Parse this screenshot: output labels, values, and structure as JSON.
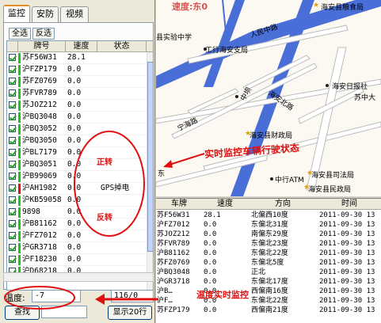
{
  "left": {
    "tabs": [
      "监控",
      "安防",
      "视频"
    ],
    "buttons": {
      "select_all": "全选",
      "invert": "反选"
    },
    "columns": [
      "牌号",
      "速度",
      "状态"
    ],
    "rows": [
      {
        "plate": "苏F56W31",
        "speed": "28.1",
        "status": "",
        "color": "#22c022"
      },
      {
        "plate": "沪FZP179",
        "speed": "0.0",
        "status": "",
        "color": "#22c022"
      },
      {
        "plate": "苏FZ0769",
        "speed": "0.0",
        "status": "",
        "color": "#22c022"
      },
      {
        "plate": "苏FVR789",
        "speed": "0.0",
        "status": "",
        "color": "#22c022"
      },
      {
        "plate": "苏JOZ212",
        "speed": "0.0",
        "status": "",
        "color": "#22c022"
      },
      {
        "plate": "沪BQ3048",
        "speed": "0.0",
        "status": "",
        "color": "#22c022"
      },
      {
        "plate": "沪BQ3052",
        "speed": "0.0",
        "status": "",
        "color": "#22c022"
      },
      {
        "plate": "沪BQ3050",
        "speed": "0.0",
        "status": "",
        "color": "#22c022"
      },
      {
        "plate": "沪BL7179",
        "speed": "0.0",
        "status": "",
        "color": "#22c022"
      },
      {
        "plate": "沪BQ3051",
        "speed": "0.0",
        "status": "",
        "color": "#22c022"
      },
      {
        "plate": "沪B99069",
        "speed": "0.0",
        "status": "",
        "color": "#22c022"
      },
      {
        "plate": "沪AH1982",
        "speed": "0.0",
        "status": "GPS掉电",
        "color": "#e01010"
      },
      {
        "plate": "沪KB59058",
        "speed": "0.0",
        "status": "",
        "color": "#22c022"
      },
      {
        "plate": "9898",
        "speed": "0.0",
        "status": "",
        "color": "#22c022"
      },
      {
        "plate": "沪B81162",
        "speed": "0.0",
        "status": "",
        "color": "#22c022"
      },
      {
        "plate": "沪FZ7012",
        "speed": "0.0",
        "status": "",
        "color": "#22c022"
      },
      {
        "plate": "沪GR3718",
        "speed": "0.0",
        "status": "",
        "color": "#22c022"
      },
      {
        "plate": "沪F18230",
        "speed": "0.0",
        "status": "",
        "color": "#22c022"
      },
      {
        "plate": "沪D68218",
        "speed": "0.0",
        "status": "",
        "color": "#22c022"
      }
    ],
    "temp_label": "温度:",
    "temp_value": "-7",
    "other_value": "116/0",
    "find_button": "查找",
    "show_button": "显示20行"
  },
  "map": {
    "speed_caption": "速度:东0",
    "labels": {
      "school": "县实验中学",
      "station": "工行海安支局",
      "people": "人民中路",
      "daily": "海安日报社",
      "finance": "海安县财政局",
      "court": "海安县司法局",
      "civil": "海安县民政局",
      "atm": "中行ATM",
      "east": "东",
      "subu": "苏中大",
      "zhongba": "中坝",
      "haian_north": "海安北路",
      "ninghai": "宁海路",
      "weigui": "海安县粮食局"
    }
  },
  "annotations": {
    "realtime": "实时监控车辆行驶状态",
    "forward": "正转",
    "reverse": "反转",
    "temp_note": "温度实时监控"
  },
  "table": {
    "columns": [
      "车牌",
      "速度",
      "方向",
      "时间"
    ],
    "rows": [
      [
        "苏F56W31",
        "28.1",
        "北偏西10度",
        "2011-09-30 13"
      ],
      [
        "沪FZ7012",
        "0.0",
        "东偏北31度",
        "2011-09-30 13"
      ],
      [
        "苏JOZ212",
        "0.0",
        "南偏东29度",
        "2011-09-30 13"
      ],
      [
        "苏FVR789",
        "0.0",
        "东偏北23度",
        "2011-09-30 13"
      ],
      [
        "沪B81162",
        "0.0",
        "东偏北22度",
        "2011-09-30 13"
      ],
      [
        "苏FZ0769",
        "0.0",
        "东偏北5度",
        "2011-09-30 13"
      ],
      [
        "沪BQ3048",
        "0.0",
        "正北",
        "2011-09-30 13"
      ],
      [
        "沪GR3718",
        "0.0",
        "东偏北17度",
        "2011-09-30 13"
      ],
      [
        "沪B…",
        "0.0",
        "西偏南16度",
        "2011-09-30 13"
      ],
      [
        "沪F…",
        "0.0",
        "东偏北22度",
        "2011-09-30 13"
      ],
      [
        "苏FZP179",
        "0.0",
        "西偏南21度",
        "2011-09-30 13"
      ]
    ]
  }
}
